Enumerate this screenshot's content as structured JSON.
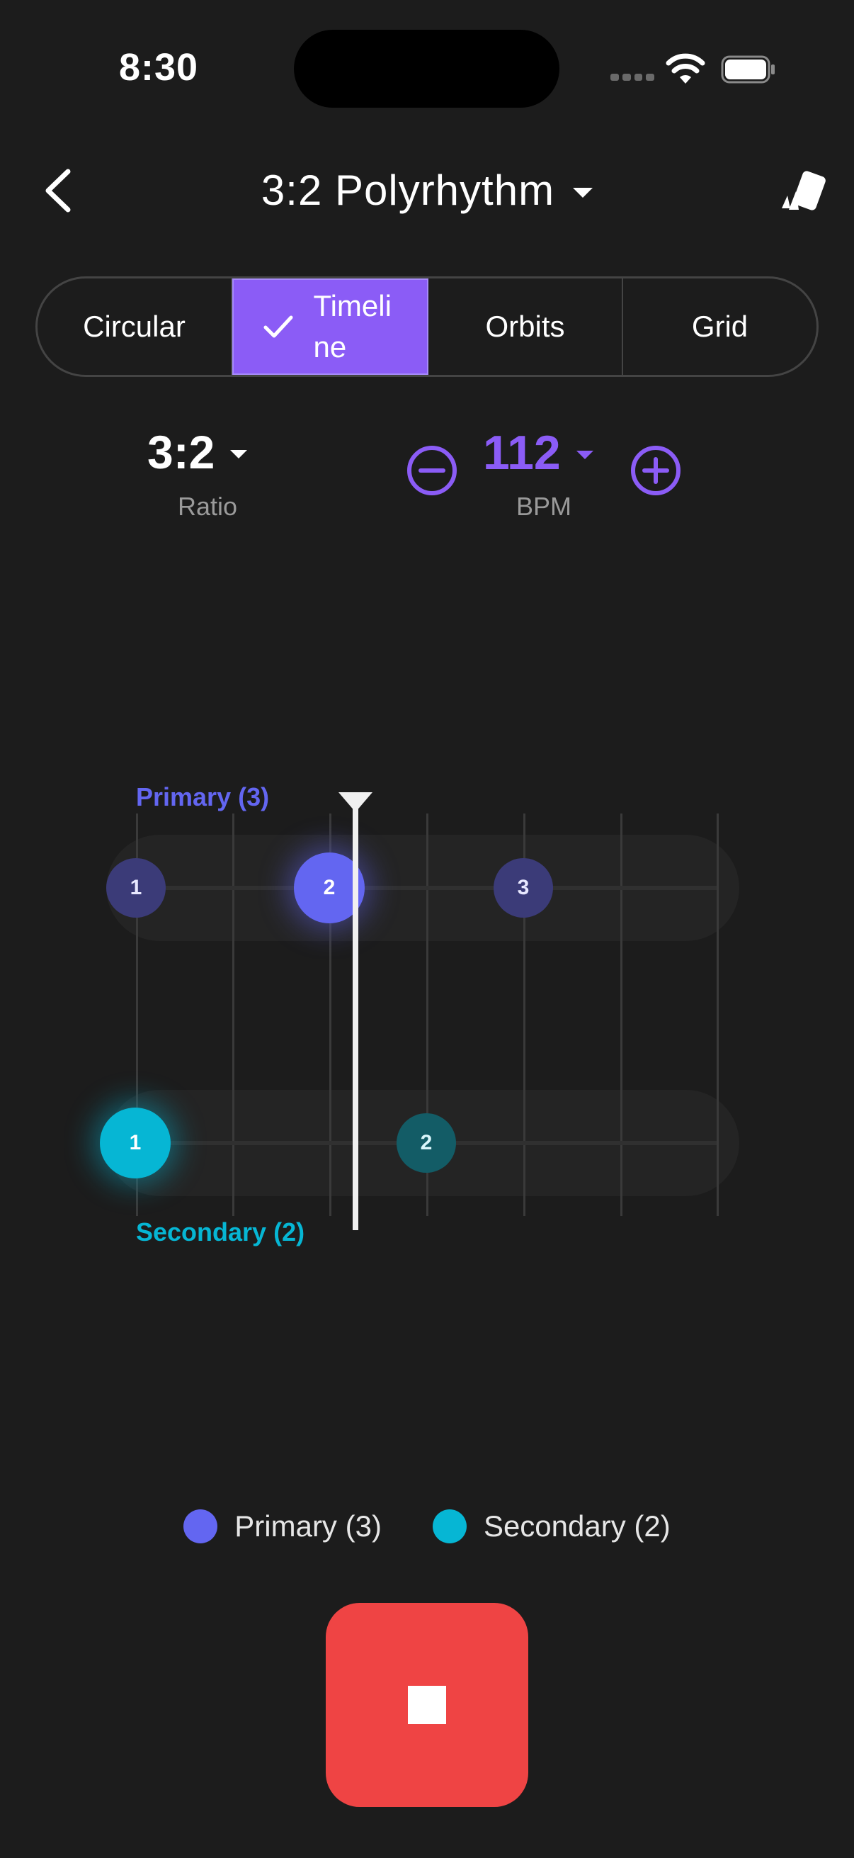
{
  "status": {
    "time": "8:30"
  },
  "header": {
    "title": "3:2 Polyrhythm"
  },
  "tabs": [
    {
      "label": "Circular",
      "active": false
    },
    {
      "label": "Timeline",
      "active": true
    },
    {
      "label": "Orbits",
      "active": false
    },
    {
      "label": "Grid",
      "active": false
    }
  ],
  "ratio": {
    "value": "3:2",
    "label": "Ratio"
  },
  "bpm": {
    "value": "112",
    "label": "BPM"
  },
  "timeline": {
    "primary_label": "Primary (3)",
    "secondary_label": "Secondary (2)",
    "primary_beats": [
      "1",
      "2",
      "3"
    ],
    "secondary_beats": [
      "1",
      "2"
    ],
    "active_primary_beat": "2",
    "active_secondary_beat": "1"
  },
  "legend": {
    "primary": "Primary (3)",
    "secondary": "Secondary (2)"
  },
  "colors": {
    "accent": "#8b5cf6",
    "primary": "#6366f1",
    "secondary": "#06b6d4",
    "stop": "#ef4444",
    "background": "#1c1c1c"
  },
  "icons": [
    "back-chevron-icon",
    "dropdown-caret-icon",
    "share-cards-icon",
    "checkmark-icon",
    "minus-circle-icon",
    "plus-circle-icon",
    "stop-icon"
  ]
}
